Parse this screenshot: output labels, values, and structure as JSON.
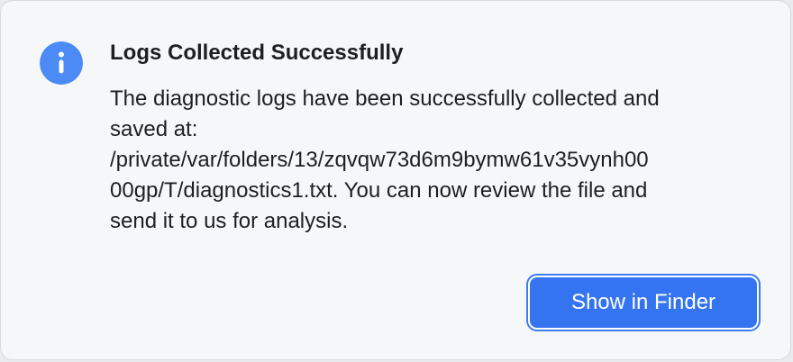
{
  "dialog": {
    "icon": "info-icon",
    "title": "Logs Collected Successfully",
    "message_lines": [
      "The diagnostic logs have been successfully collected and",
      "saved at:",
      "/private/var/folders/13/zqvqw73d6m9bymw61v35vynh00",
      "00gp/T/diagnostics1.txt. You can now review the file and",
      "send it to us for analysis."
    ],
    "show_in_finder_label": "Show in Finder"
  },
  "colors": {
    "accent": "#3574f0",
    "icon": "#4c8bf5",
    "background": "#f6f7f9",
    "text": "#1e1f22"
  }
}
